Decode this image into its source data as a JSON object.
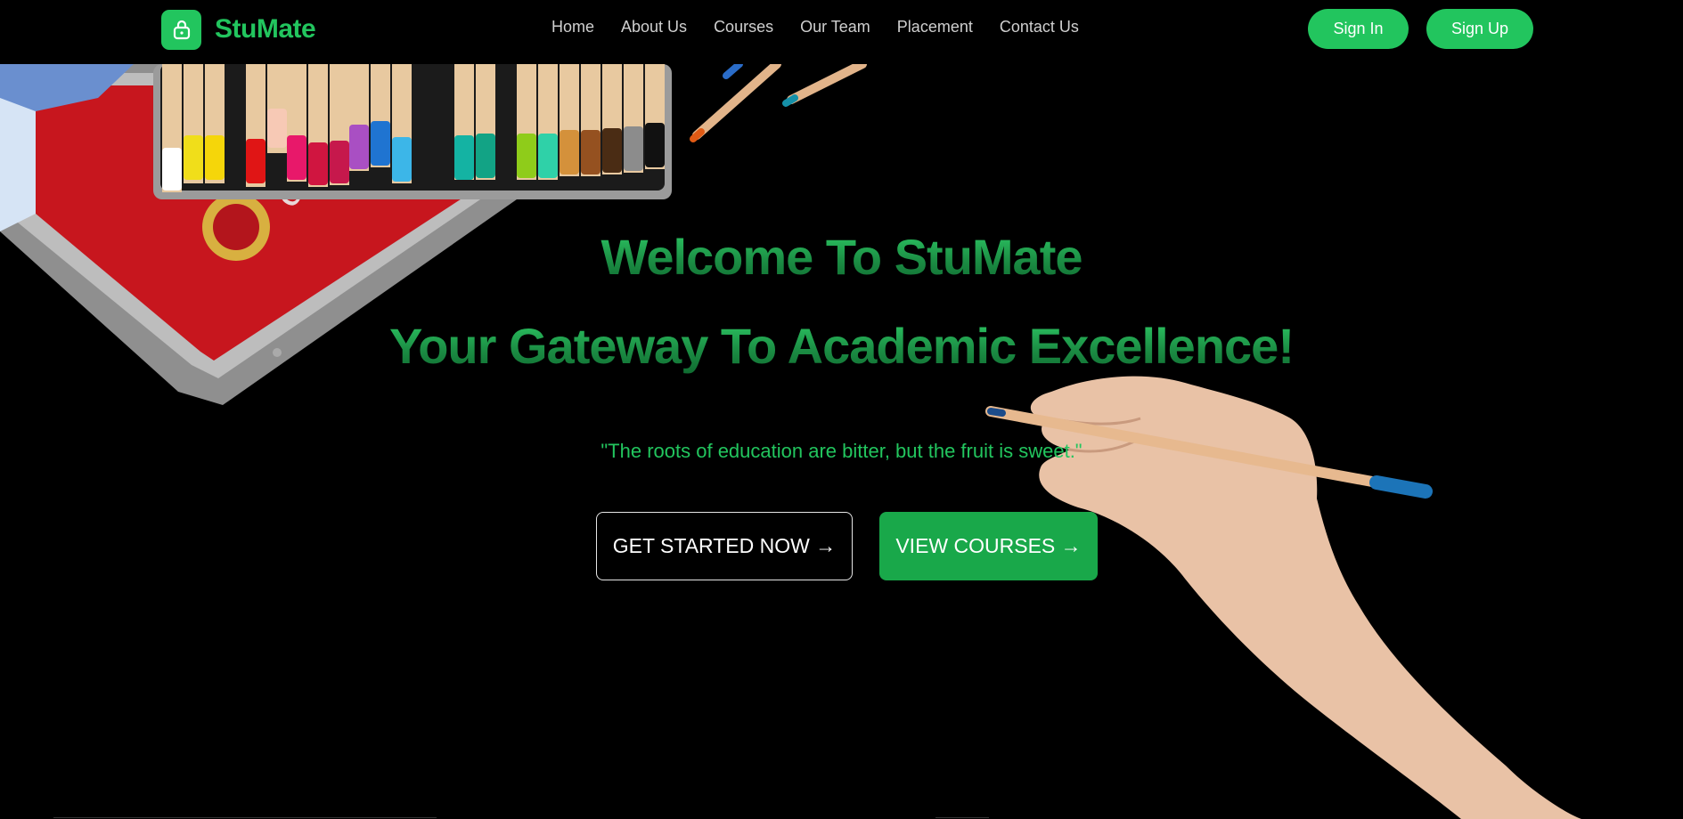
{
  "brand": {
    "name": "StuMate",
    "logo_icon": "lock-icon",
    "accent": "#22c55e"
  },
  "nav": {
    "items": [
      {
        "label": "Home"
      },
      {
        "label": "About Us"
      },
      {
        "label": "Courses"
      },
      {
        "label": "Our Team"
      },
      {
        "label": "Placement"
      },
      {
        "label": "Contact Us"
      }
    ],
    "sign_in": "Sign In",
    "sign_up": "Sign Up"
  },
  "hero": {
    "title_line1": "Welcome To StuMate",
    "title_line2": "Your Gateway To Academic Excellence!",
    "quote": "\"The roots of education are bitter, but the fruit is sweet.\"",
    "primary_cta": "GET STARTED NOW →",
    "secondary_cta": "VIEW COURSES →"
  },
  "colors": {
    "background": "#000000",
    "accent": "#22c55e",
    "button_green": "#19a84a"
  }
}
